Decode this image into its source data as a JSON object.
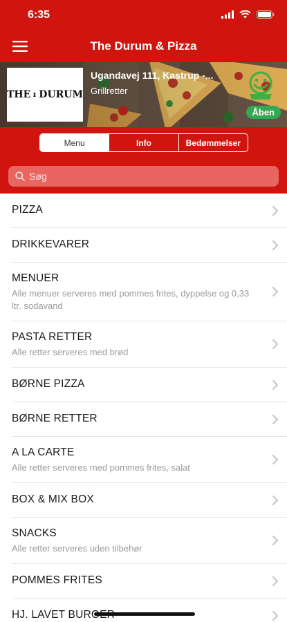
{
  "status_bar": {
    "time": "6:35"
  },
  "nav": {
    "title": "The Durum & Pizza"
  },
  "restaurant": {
    "logo_text_left": "THE",
    "logo_text_right": "DURUM",
    "address": "Ugandavej 111, Kastrup -...",
    "category": "Grillretter",
    "open_status": "Åben"
  },
  "tabs": [
    {
      "label": "Menu",
      "active": true
    },
    {
      "label": "Info",
      "active": false
    },
    {
      "label": "Bedømmelser",
      "active": false
    }
  ],
  "search": {
    "placeholder": "Søg",
    "value": ""
  },
  "categories": [
    {
      "title": "PIZZA",
      "subtitle": ""
    },
    {
      "title": "DRIKKEVARER",
      "subtitle": ""
    },
    {
      "title": "MENUER",
      "subtitle": "Alle menuer serveres med pommes frites, dyppelse og 0,33 ltr. sodavand"
    },
    {
      "title": "PASTA RETTER",
      "subtitle": "Alle retter serveres med brød"
    },
    {
      "title": "BØRNE PIZZA",
      "subtitle": ""
    },
    {
      "title": "BØRNE RETTER",
      "subtitle": ""
    },
    {
      "title": "A LA CARTE",
      "subtitle": "Alle retter serveres med pommes frites, salat"
    },
    {
      "title": "BOX & MIX BOX",
      "subtitle": ""
    },
    {
      "title": "SNACKS",
      "subtitle": "Alle retter serveres uden tilbehør"
    },
    {
      "title": "POMMES FRITES",
      "subtitle": ""
    },
    {
      "title": "HJ. LAVET BURGER",
      "subtitle": ""
    }
  ],
  "colors": {
    "brand_red": "#d0150f",
    "open_green": "#34a853",
    "smiley_green": "#3cb043"
  },
  "icons": {
    "menu": "hamburger-icon",
    "search": "search-icon",
    "chevron": "chevron-right-icon",
    "smiley": "smiley-icon"
  }
}
